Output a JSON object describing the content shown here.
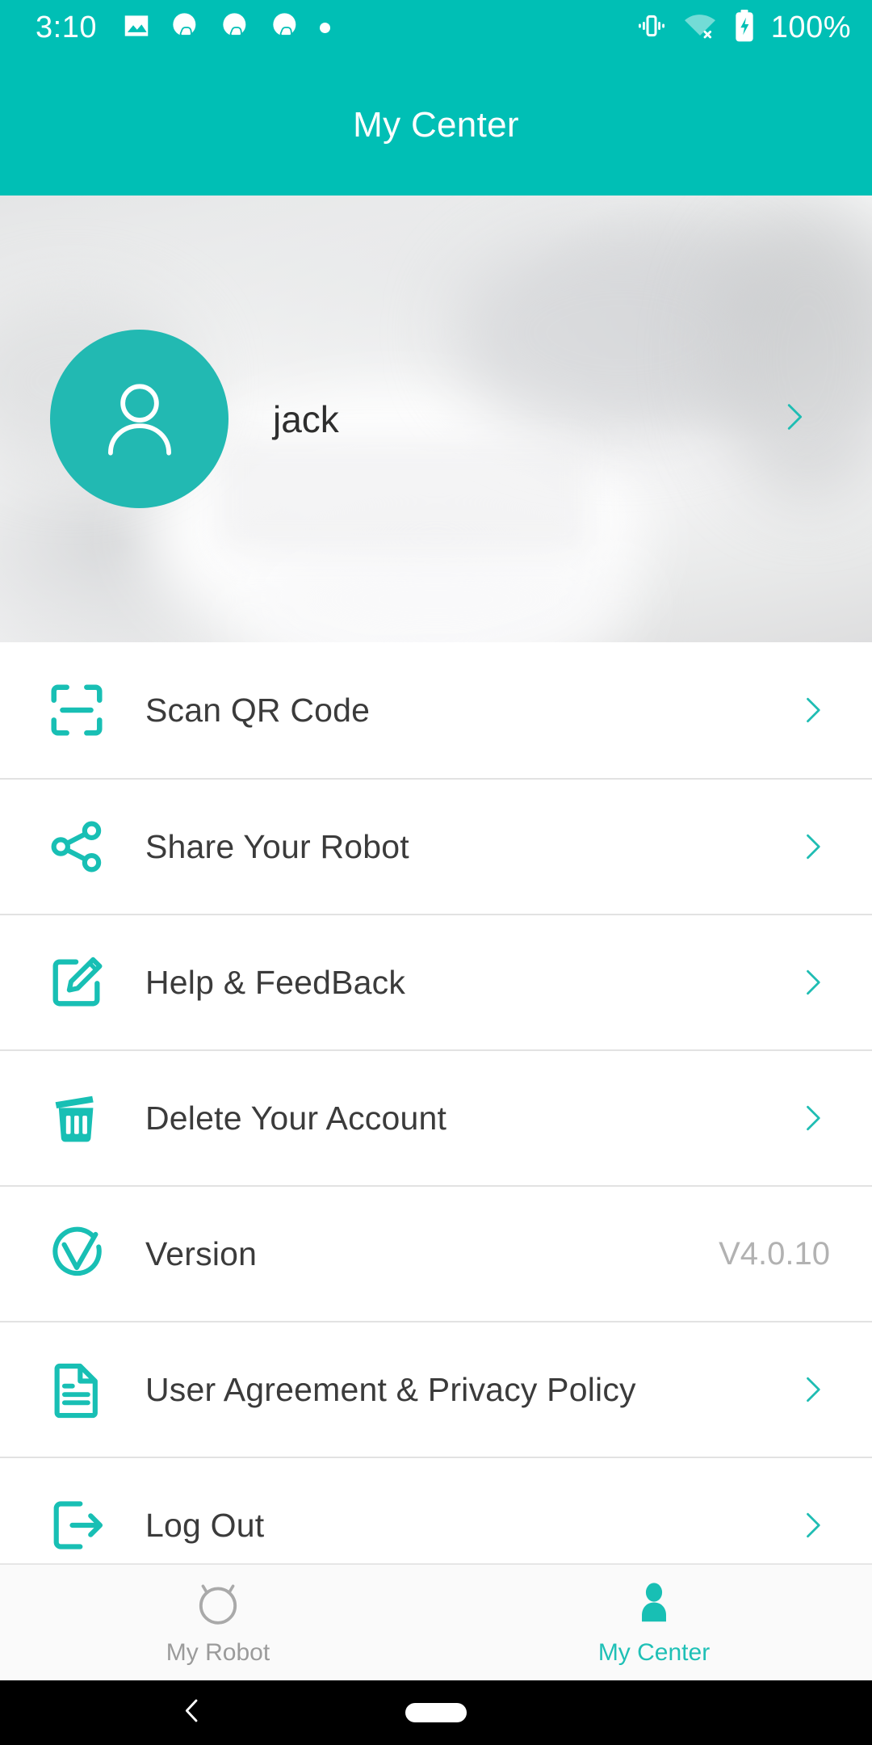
{
  "status_bar": {
    "time": "3:10",
    "left_icons": [
      "image-icon",
      "notification-icon",
      "notification-icon",
      "notification-icon",
      "dot-icon"
    ],
    "right_icons": [
      "vibrate-icon",
      "wifi-off-icon",
      "battery-charging-icon"
    ],
    "battery_percent": "100%"
  },
  "header": {
    "title": "My Center",
    "accent_color": "#00bfb5"
  },
  "profile": {
    "username": "jack",
    "avatar_icon": "person-icon",
    "avatar_color": "#22b9b2",
    "chevron_icon": "chevron-right-icon"
  },
  "menu": {
    "items": [
      {
        "label": "Scan QR Code",
        "icon": "qr-scan-icon",
        "value": "",
        "has_chevron": true
      },
      {
        "label": "Share Your Robot",
        "icon": "share-icon",
        "value": "",
        "has_chevron": true
      },
      {
        "label": "Help & FeedBack",
        "icon": "edit-square-icon",
        "value": "",
        "has_chevron": true
      },
      {
        "label": "Delete Your Account",
        "icon": "trash-icon",
        "value": "",
        "has_chevron": true
      },
      {
        "label": "Version",
        "icon": "version-check-icon",
        "value": "V4.0.10",
        "has_chevron": false
      },
      {
        "label": "User Agreement & Privacy Policy",
        "icon": "document-icon",
        "value": "",
        "has_chevron": true
      },
      {
        "label": "Log Out",
        "icon": "logout-icon",
        "value": "",
        "has_chevron": true
      }
    ],
    "icon_color": "#18bfb4",
    "label_color": "#3b3b3b",
    "value_color": "#b2b2b2"
  },
  "bottom_nav": {
    "items": [
      {
        "label": "My Robot",
        "icon": "robot-vacuum-icon",
        "active": false
      },
      {
        "label": "My Center",
        "icon": "person-filled-icon",
        "active": true
      }
    ],
    "active_color": "#1fc0b6",
    "inactive_color": "#9b9b9b"
  },
  "android_nav": {
    "back_icon": "back-chevron-icon",
    "home_icon": "home-pill-icon"
  }
}
